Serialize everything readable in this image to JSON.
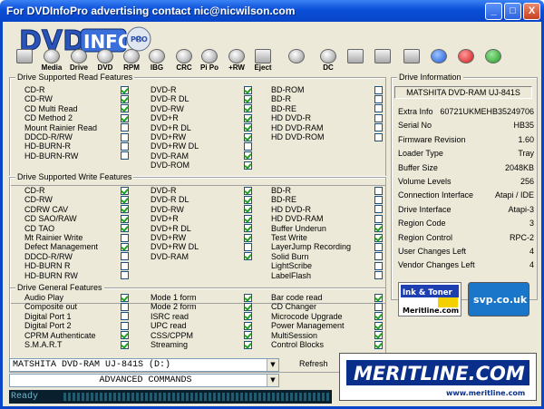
{
  "window": {
    "title": "For DVDInfoPro advertising contact nic@nicwilson.com",
    "min": "_",
    "max": "□",
    "close": "X"
  },
  "logo": {
    "text": "DVD",
    "text2": "INFO",
    "badge": "PRO"
  },
  "toolbar": [
    {
      "name": "monitor",
      "label": ""
    },
    {
      "name": "media",
      "label": "Media"
    },
    {
      "name": "drive",
      "label": "Drive"
    },
    {
      "name": "dvd",
      "label": "DVD"
    },
    {
      "name": "rpm",
      "label": "RPM"
    },
    {
      "name": "ibg",
      "label": "IBG"
    },
    {
      "name": "crc",
      "label": "CRC"
    },
    {
      "name": "pipo",
      "label": "Pi Po"
    },
    {
      "name": "plusrw",
      "label": "+RW"
    },
    {
      "name": "eject",
      "label": "Eject"
    },
    {
      "name": "disc",
      "label": ""
    },
    {
      "name": "dc",
      "label": "DC"
    },
    {
      "name": "clipboard",
      "label": ""
    },
    {
      "name": "camera",
      "label": ""
    },
    {
      "name": "notepad",
      "label": ""
    },
    {
      "name": "info",
      "label": ""
    },
    {
      "name": "help",
      "label": ""
    },
    {
      "name": "dollar",
      "label": ""
    }
  ],
  "read": {
    "title": "Drive Supported Read Features",
    "col1": [
      [
        "CD-R",
        true
      ],
      [
        "CD-RW",
        true
      ],
      [
        "CD Multi Read",
        true
      ],
      [
        "CD Method 2",
        true
      ],
      [
        "Mount Rainier Read",
        false
      ],
      [
        "DDCD-R/RW",
        false
      ],
      [
        "HD-BURN-R",
        false
      ],
      [
        "HD-BURN-RW",
        false
      ]
    ],
    "col2": [
      [
        "DVD-R",
        true
      ],
      [
        "DVD-R DL",
        true
      ],
      [
        "DVD-RW",
        true
      ],
      [
        "DVD+R",
        true
      ],
      [
        "DVD+R DL",
        true
      ],
      [
        "DVD+RW",
        true
      ],
      [
        "DVD+RW DL",
        false
      ],
      [
        "DVD-RAM",
        true
      ],
      [
        "DVD-ROM",
        true
      ]
    ],
    "col3": [
      [
        "BD-ROM",
        false
      ],
      [
        "BD-R",
        false
      ],
      [
        "BD-RE",
        false
      ],
      [
        "HD DVD-R",
        false
      ],
      [
        "HD DVD-RAM",
        false
      ],
      [
        "HD DVD-ROM",
        false
      ]
    ]
  },
  "write": {
    "title": "Drive Supported Write Features",
    "col1": [
      [
        "CD-R",
        true
      ],
      [
        "CD-RW",
        true
      ],
      [
        "CDRW CAV",
        true
      ],
      [
        "CD SAO/RAW",
        true
      ],
      [
        "CD TAO",
        true
      ],
      [
        "Mt Rainier Write",
        false
      ],
      [
        "Defect Management",
        true
      ],
      [
        "DDCD-R/RW",
        false
      ],
      [
        "HD-BURN R",
        false
      ],
      [
        "HD-BURN RW",
        false
      ]
    ],
    "col2": [
      [
        "DVD-R",
        true
      ],
      [
        "DVD-R DL",
        true
      ],
      [
        "DVD-RW",
        true
      ],
      [
        "DVD+R",
        true
      ],
      [
        "DVD+R DL",
        true
      ],
      [
        "DVD+RW",
        true
      ],
      [
        "DVD+RW DL",
        false
      ],
      [
        "DVD-RAM",
        true
      ]
    ],
    "col3": [
      [
        "BD-R",
        false
      ],
      [
        "BD-RE",
        false
      ],
      [
        "HD DVD-R",
        false
      ],
      [
        "HD DVD-RAM",
        false
      ],
      [
        "Buffer Underun",
        true
      ],
      [
        "Test Write",
        true
      ],
      [
        "LayerJump Recording",
        false
      ],
      [
        "Solid Burn",
        false
      ],
      [
        "LightScribe",
        false
      ],
      [
        "LabelFlash",
        false
      ]
    ]
  },
  "general": {
    "title": "Drive General Features",
    "col1": [
      [
        "Audio Play",
        true
      ],
      [
        "Composite out",
        false
      ],
      [
        "Digital Port 1",
        false
      ],
      [
        "Digital Port 2",
        false
      ],
      [
        "CPRM Authenticate",
        true
      ],
      [
        "S.M.A.R.T",
        true
      ]
    ],
    "col2": [
      [
        "Mode 1 form",
        true
      ],
      [
        "Mode 2 form",
        true
      ],
      [
        "ISRC read",
        true
      ],
      [
        "UPC read",
        true
      ],
      [
        "CSS/CPPM",
        true
      ],
      [
        "Streaming",
        true
      ]
    ],
    "col3": [
      [
        "Bar code read",
        true
      ],
      [
        "CD Changer",
        false
      ],
      [
        "Microcode Upgrade",
        true
      ],
      [
        "Power Management",
        true
      ],
      [
        "MultiSession",
        true
      ],
      [
        "Control Blocks",
        true
      ]
    ]
  },
  "info": {
    "title": "Drive Information",
    "model": "MATSHITA DVD-RAM UJ-841S",
    "rows": [
      [
        "Extra Info",
        "60721UKMEHB35249706"
      ],
      [
        "Serial No",
        "HB35"
      ],
      [
        "Firmware Revision",
        "1.60"
      ],
      [
        "Loader Type",
        "Tray"
      ],
      [
        "Buffer Size",
        "2048KB"
      ],
      [
        "Volume Levels",
        "256"
      ],
      [
        "Connection Interface",
        "Atapi / IDE"
      ],
      [
        "Drive Interface",
        "Atapi-3"
      ],
      [
        "Region Code",
        "3"
      ],
      [
        "Region Control",
        "RPC-2"
      ],
      [
        "User Changes Left",
        "4"
      ],
      [
        "Vendor Changes Left",
        "4"
      ]
    ]
  },
  "ads": {
    "ink1": "Ink & Toner",
    "ink2": "Meritline.com",
    "svp": "svp.co.uk",
    "merit": "MERITLINE.COM",
    "merit_url": "www.meritline.com"
  },
  "drive_select": "MATSHITA DVD-RAM UJ-841S (D:)",
  "mode_select": "ADVANCED COMMANDS",
  "refresh": "Refresh",
  "status": "Ready",
  "colors": {
    "titlebar": "#0845c8",
    "face": "#ece9d8",
    "check": "#21a121"
  }
}
